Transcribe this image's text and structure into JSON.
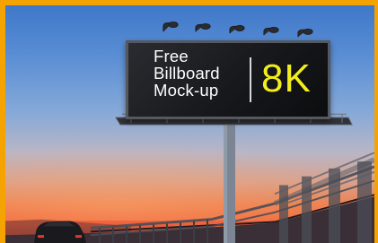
{
  "billboard": {
    "line1": "Free",
    "line2": "Billboard",
    "line3": "Mock-up",
    "resolution": "8K"
  },
  "colors": {
    "border": "#f5a300",
    "sky_top": "#3f78c9",
    "sunset": "#f0633a",
    "accent_text": "#f2ee1e",
    "board_face": "#17181b"
  }
}
